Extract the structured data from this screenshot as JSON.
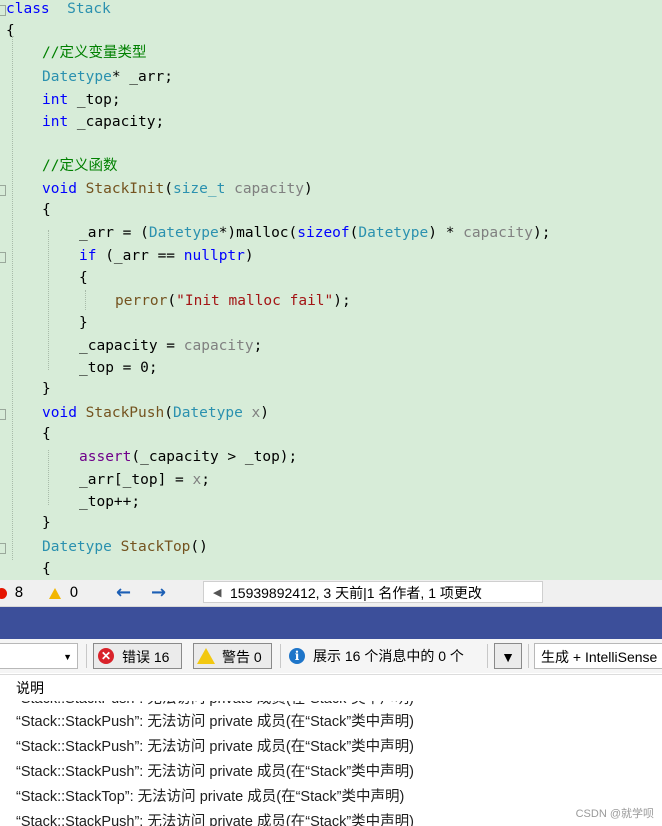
{
  "code": {
    "lines": [
      {
        "segs": [
          [
            "kw",
            "class"
          ],
          [
            "",
            "  "
          ],
          [
            "ty",
            "Stack"
          ]
        ]
      },
      {
        "segs": [
          [
            "",
            "{"
          ]
        ]
      },
      {
        "segs": [
          [
            "cm",
            "//定义变量类型"
          ]
        ]
      },
      {
        "segs": [
          [
            "ty",
            "Datetype"
          ],
          [
            "",
            "* _arr;"
          ]
        ]
      },
      {
        "segs": [
          [
            "kw",
            "int"
          ],
          [
            "",
            " _top;"
          ]
        ]
      },
      {
        "segs": [
          [
            "kw",
            "int"
          ],
          [
            "",
            " _capacity;"
          ]
        ]
      },
      {
        "segs": [
          [
            "",
            ""
          ]
        ]
      },
      {
        "segs": [
          [
            "cm",
            "//定义函数"
          ]
        ]
      },
      {
        "segs": [
          [
            "kw",
            "void"
          ],
          [
            "",
            " "
          ],
          [
            "fn",
            "StackInit"
          ],
          [
            "",
            "("
          ],
          [
            "ty",
            "size_t"
          ],
          [
            "",
            " "
          ],
          [
            "pm",
            "capacity"
          ],
          [
            "",
            ")"
          ]
        ]
      },
      {
        "segs": [
          [
            "",
            "{"
          ]
        ]
      },
      {
        "segs": [
          [
            "",
            "_arr = ("
          ],
          [
            "ty",
            "Datetype"
          ],
          [
            "",
            "*)malloc("
          ],
          [
            "kw",
            "sizeof"
          ],
          [
            "",
            "("
          ],
          [
            "ty",
            "Datetype"
          ],
          [
            "",
            ") * "
          ],
          [
            "pm",
            "capacity"
          ],
          [
            "",
            ");"
          ]
        ]
      },
      {
        "segs": [
          [
            "kw",
            "if"
          ],
          [
            "",
            " (_arr == "
          ],
          [
            "kw",
            "nullptr"
          ],
          [
            "",
            ")"
          ]
        ]
      },
      {
        "segs": [
          [
            "",
            "{"
          ]
        ]
      },
      {
        "segs": [
          [
            "fn",
            "perror"
          ],
          [
            "",
            "("
          ],
          [
            "str",
            "\"Init malloc fail\""
          ],
          [
            "",
            ");"
          ]
        ]
      },
      {
        "segs": [
          [
            "",
            "}"
          ]
        ]
      },
      {
        "segs": [
          [
            "",
            "_capacity = "
          ],
          [
            "pm",
            "capacity"
          ],
          [
            "",
            ";"
          ]
        ]
      },
      {
        "segs": [
          [
            "",
            "_top = 0;"
          ]
        ]
      },
      {
        "segs": [
          [
            "",
            "}"
          ]
        ]
      },
      {
        "segs": [
          [
            "kw",
            "void"
          ],
          [
            "",
            " "
          ],
          [
            "fn",
            "StackPush"
          ],
          [
            "",
            "("
          ],
          [
            "ty",
            "Datetype"
          ],
          [
            "",
            " "
          ],
          [
            "pm",
            "x"
          ],
          [
            "",
            ")"
          ]
        ]
      },
      {
        "segs": [
          [
            "",
            "{"
          ]
        ]
      },
      {
        "segs": [
          [
            "mac",
            "assert"
          ],
          [
            "",
            "(_capacity > _top);"
          ]
        ]
      },
      {
        "segs": [
          [
            "",
            "_arr[_top] = "
          ],
          [
            "pm",
            "x"
          ],
          [
            "",
            ";"
          ]
        ]
      },
      {
        "segs": [
          [
            "",
            "_top++;"
          ]
        ]
      },
      {
        "segs": [
          [
            "",
            "}"
          ]
        ]
      },
      {
        "segs": [
          [
            "ty",
            "Datetype"
          ],
          [
            "",
            " "
          ],
          [
            "fn",
            "StackTop"
          ],
          [
            "",
            "()"
          ]
        ]
      },
      {
        "segs": [
          [
            "",
            "{"
          ]
        ]
      }
    ]
  },
  "status_bar": {
    "error_count": "8",
    "warning_count": "0",
    "codelens_text": "15939892412, 3 天前|1 名作者, 1 项更改"
  },
  "error_toolbar": {
    "errors_label": "错误 16",
    "warnings_label": "警告 0",
    "messages_label": "展示 16 个消息中的 0 个",
    "build_filter": "生成 + IntelliSense"
  },
  "error_list": {
    "column_header": "说明",
    "rows": [
      "“Stack::StackPush”: 无法访问 private 成员(在“Stack”类中声明)",
      "“Stack::StackPush”: 无法访问 private 成员(在“Stack”类中声明)",
      "“Stack::StackPush”: 无法访问 private 成员(在“Stack”类中声明)",
      "“Stack::StackPush”: 无法访问 private 成员(在“Stack”类中声明)",
      "“Stack::StackTop”: 无法访问 private 成员(在“Stack”类中声明)",
      "“Stack::StackPush”: 无法访问 private 成员(在“Stack”类中声明)"
    ]
  },
  "watermark": "CSDN @就学呗",
  "colors": {
    "editor_bg": "#d7ecd8",
    "keyword": "#0000ff",
    "type": "#2b91af",
    "comment": "#008000",
    "error": "#e51400",
    "warning": "#f2b600"
  }
}
